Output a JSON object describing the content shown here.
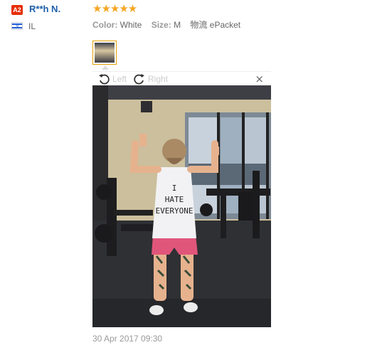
{
  "reviewer": {
    "badge": "A2",
    "name": "R**h N.",
    "country": "IL"
  },
  "rating": {
    "stars": 5,
    "display": "★★★★★"
  },
  "attributes": [
    {
      "key": "Color:",
      "value": "White"
    },
    {
      "key": "Size:",
      "value": "M"
    },
    {
      "key": "物流",
      "value": "ePacket"
    }
  ],
  "viewer": {
    "rotate_left_label": "Left",
    "rotate_right_label": "Right",
    "close_glyph": "×",
    "shirt_text": [
      "I",
      "HATE",
      "EVERYONE"
    ]
  },
  "review_date": "30 Apr 2017 09:30",
  "colors": {
    "accent": "#e62e04",
    "link": "#1c5ea8",
    "star": "#f5a623"
  }
}
